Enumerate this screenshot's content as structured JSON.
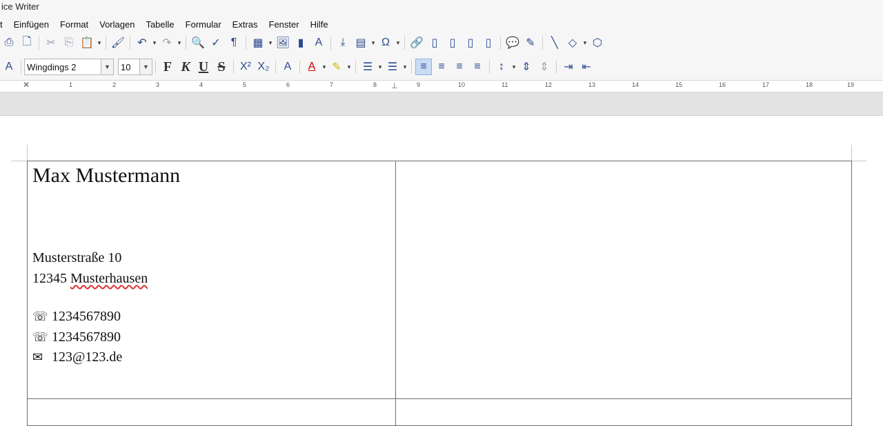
{
  "window": {
    "title": "ice Writer"
  },
  "menubar": {
    "items": [
      "t",
      "Einfügen",
      "Format",
      "Vorlagen",
      "Tabelle",
      "Formular",
      "Extras",
      "Fenster",
      "Hilfe"
    ]
  },
  "format_toolbar": {
    "font_name": "Wingdings 2",
    "font_size": "10",
    "bold": "F",
    "italic": "K",
    "underline": "U",
    "strike": "S"
  },
  "ruler": {
    "labels": [
      "1",
      "2",
      "3",
      "4",
      "5",
      "6",
      "7",
      "8",
      "9",
      "10",
      "11",
      "12",
      "13",
      "14",
      "15",
      "16",
      "17",
      "18",
      "19"
    ]
  },
  "document": {
    "name": "Max Mustermann",
    "street": "Musterstraße 10",
    "city_prefix": "12345",
    "city": "Musterhausen",
    "phone1": "1234567890",
    "phone2": "1234567890",
    "email": "123@123.de",
    "phone_glyph": "☏",
    "mail_glyph": "✉"
  },
  "icons": [
    "print-icon",
    "print-preview-icon",
    "cut-icon",
    "copy-icon",
    "paste-icon",
    "clone-format-icon",
    "undo-icon",
    "redo-icon",
    "find-replace-icon",
    "spellcheck-icon",
    "formatting-marks-icon",
    "insert-table-icon",
    "insert-image-icon",
    "insert-chart-icon",
    "insert-textbox-icon",
    "page-break-icon",
    "insert-field-icon",
    "special-character-icon",
    "hyperlink-icon",
    "footnote-icon",
    "endnote-icon",
    "bookmark-icon",
    "cross-reference-icon",
    "comment-icon",
    "track-changes-icon",
    "line-icon",
    "shapes-icon",
    "draw-functions-icon"
  ]
}
